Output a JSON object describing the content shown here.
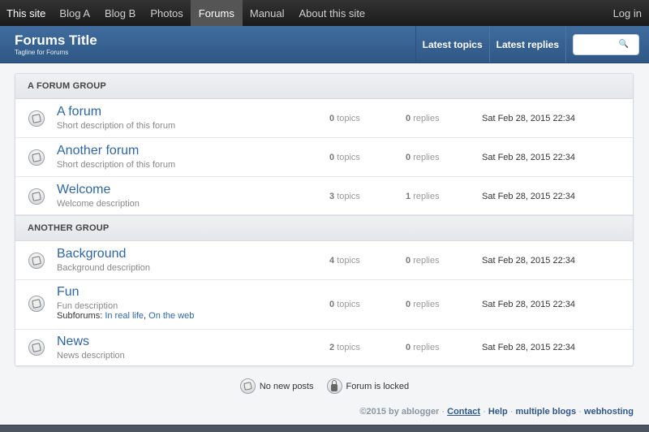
{
  "topnav": {
    "site": "This site",
    "items": [
      "Blog A",
      "Blog B",
      "Photos",
      "Forums",
      "Manual",
      "About this site"
    ],
    "active": "Forums",
    "login": "Log in"
  },
  "header": {
    "title": "Forums Title",
    "tagline": "Tagline for Forums",
    "latest_topics": "Latest topics",
    "latest_replies": "Latest replies",
    "search_placeholder": ""
  },
  "groups": [
    {
      "name": "A FORUM GROUP",
      "forums": [
        {
          "name": "A forum",
          "desc": "Short description of this forum",
          "topics": "0",
          "topics_label": "topics",
          "replies": "0",
          "replies_label": "replies",
          "date": "Sat Feb 28, 2015 22:34"
        },
        {
          "name": "Another forum",
          "desc": "Short description of this forum",
          "topics": "0",
          "topics_label": "topics",
          "replies": "0",
          "replies_label": "replies",
          "date": "Sat Feb 28, 2015 22:34"
        },
        {
          "name": "Welcome",
          "desc": "Welcome description",
          "topics": "3",
          "topics_label": "topics",
          "replies": "1",
          "replies_label": "replies",
          "date": "Sat Feb 28, 2015 22:34"
        }
      ]
    },
    {
      "name": "ANOTHER GROUP",
      "forums": [
        {
          "name": "Background",
          "desc": "Background description",
          "topics": "4",
          "topics_label": "topics",
          "replies": "0",
          "replies_label": "replies",
          "date": "Sat Feb 28, 2015 22:34"
        },
        {
          "name": "Fun",
          "desc": "Fun description",
          "topics": "0",
          "topics_label": "topics",
          "replies": "0",
          "replies_label": "replies",
          "date": "Sat Feb 28, 2015 22:34",
          "subforums_label": "Subforums:",
          "subforums": [
            "In real life",
            "On the web"
          ]
        },
        {
          "name": "News",
          "desc": "News description",
          "topics": "2",
          "topics_label": "topics",
          "replies": "0",
          "replies_label": "replies",
          "date": "Sat Feb 28, 2015 22:34"
        }
      ]
    }
  ],
  "legend": {
    "no_new": "No new posts",
    "locked": "Forum is locked"
  },
  "footer": {
    "copyright": "©2015 by",
    "author": "ablogger",
    "sep": "·",
    "contact": "Contact",
    "help": "Help",
    "multiple_blogs": "multiple blogs",
    "webhosting": "webhosting"
  },
  "icons": {
    "forum": "forum-read-icon",
    "locked": "lock-icon",
    "search": "search-icon"
  },
  "colors": {
    "header_blue": "#345f8f",
    "link_blue": "#2f66a0",
    "topnav_dark": "#222222"
  }
}
